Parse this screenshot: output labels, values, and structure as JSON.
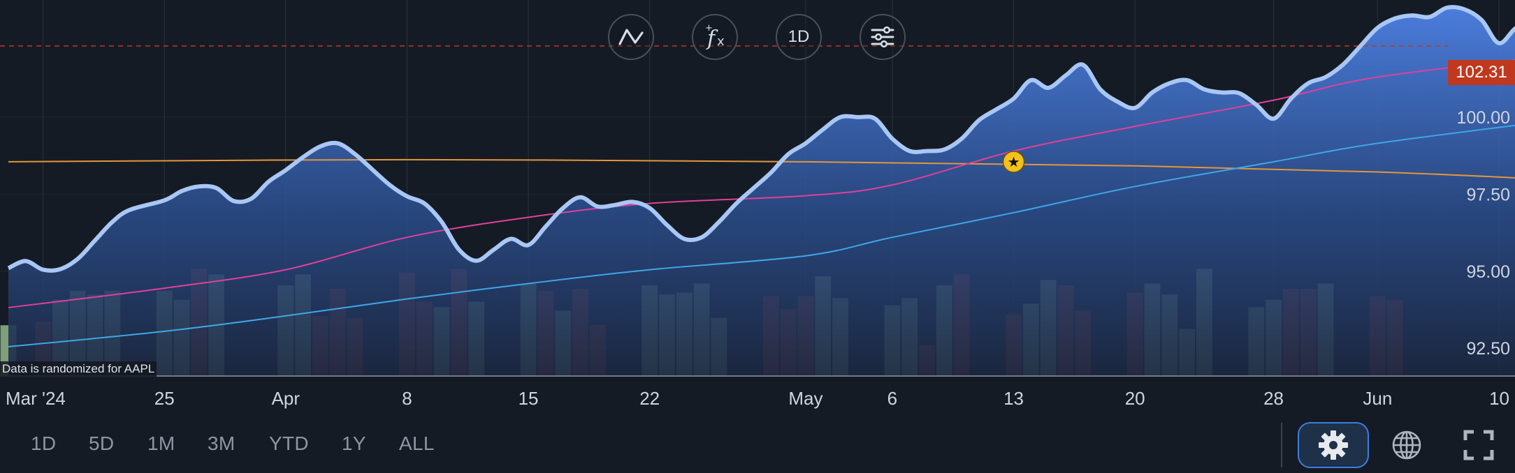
{
  "toolbar": {
    "chart_type_icon": "line-chart-icon",
    "indicator_icon": "function-fx-icon",
    "interval_label": "1D",
    "settings_icon": "sliders-icon"
  },
  "ranges": [
    "1D",
    "5D",
    "1M",
    "3M",
    "YTD",
    "1Y",
    "ALL"
  ],
  "disclaimer": "Data is randomized for AAPL",
  "last_price": "102.31",
  "bottom_icons": [
    "gear-icon",
    "globe-icon",
    "fullscreen-icon"
  ],
  "colors": {
    "background": "#151b24",
    "price_line": "#a9c7f5",
    "area_top": "#4e82e6",
    "area_bottom": "#1b2740",
    "ma_pink": "#e0409a",
    "ma_blue": "#3fa6e6",
    "ma_orange": "#e4963a",
    "volume_up": "#7e9f79",
    "volume_down": "#8c3a2e",
    "price_tag": "#c0391f",
    "accent": "#3d7de0"
  },
  "chart_data": {
    "type": "line",
    "symbol": "AAPL",
    "interval": "1D",
    "x_ticks": [
      {
        "label": "Mar '24",
        "date": "2024-03-18"
      },
      {
        "label": "25",
        "date": "2024-03-25"
      },
      {
        "label": "Apr",
        "date": "2024-04-01"
      },
      {
        "label": "8",
        "date": "2024-04-08"
      },
      {
        "label": "15",
        "date": "2024-04-15"
      },
      {
        "label": "22",
        "date": "2024-04-22"
      },
      {
        "label": "May",
        "date": "2024-05-01"
      },
      {
        "label": "6",
        "date": "2024-05-06"
      },
      {
        "label": "13",
        "date": "2024-05-13"
      },
      {
        "label": "20",
        "date": "2024-05-20"
      },
      {
        "label": "28",
        "date": "2024-05-28"
      },
      {
        "label": "Jun",
        "date": "2024-06-03"
      },
      {
        "label": "10",
        "date": "2024-06-10"
      }
    ],
    "y_ticks": [
      "92.50",
      "95.00",
      "97.50",
      "100.00"
    ],
    "y_tick_values": [
      92.5,
      95.0,
      97.5,
      100.0
    ],
    "ylim": [
      91.6,
      103.8
    ],
    "xlim": [
      "2024-03-16",
      "2024-06-10"
    ],
    "price_series": [
      [
        "2024-03-16",
        95.1
      ],
      [
        "2024-03-17",
        95.33
      ],
      [
        "2024-03-18",
        95.05
      ],
      [
        "2024-03-19",
        95.07
      ],
      [
        "2024-03-20",
        95.4
      ],
      [
        "2024-03-21",
        96.0
      ],
      [
        "2024-03-22",
        96.6
      ],
      [
        "2024-03-23",
        96.99
      ],
      [
        "2024-03-25",
        97.3
      ],
      [
        "2024-03-26",
        97.6
      ],
      [
        "2024-03-27",
        97.75
      ],
      [
        "2024-03-28",
        97.7
      ],
      [
        "2024-03-29",
        97.28
      ],
      [
        "2024-03-30",
        97.35
      ],
      [
        "2024-03-31",
        97.9
      ],
      [
        "2024-04-01",
        98.28
      ],
      [
        "2024-04-02",
        98.7
      ],
      [
        "2024-04-03",
        99.05
      ],
      [
        "2024-04-04",
        99.15
      ],
      [
        "2024-04-05",
        98.8
      ],
      [
        "2024-04-06",
        98.3
      ],
      [
        "2024-04-07",
        97.8
      ],
      [
        "2024-04-08",
        97.43
      ],
      [
        "2024-04-09",
        97.2
      ],
      [
        "2024-04-10",
        96.6
      ],
      [
        "2024-04-11",
        95.7
      ],
      [
        "2024-04-12",
        95.34
      ],
      [
        "2024-04-13",
        95.7
      ],
      [
        "2024-04-14",
        96.05
      ],
      [
        "2024-04-15",
        95.85
      ],
      [
        "2024-04-16",
        96.45
      ],
      [
        "2024-04-17",
        97.05
      ],
      [
        "2024-04-18",
        97.4
      ],
      [
        "2024-04-19",
        97.1
      ],
      [
        "2024-04-20",
        97.15
      ],
      [
        "2024-04-21",
        97.25
      ],
      [
        "2024-04-22",
        97.05
      ],
      [
        "2024-04-23",
        96.5
      ],
      [
        "2024-04-24",
        96.05
      ],
      [
        "2024-04-25",
        96.1
      ],
      [
        "2024-04-26",
        96.6
      ],
      [
        "2024-04-27",
        97.2
      ],
      [
        "2024-04-28",
        97.7
      ],
      [
        "2024-04-29",
        98.2
      ],
      [
        "2024-04-30",
        98.8
      ],
      [
        "2024-05-01",
        99.15
      ],
      [
        "2024-05-02",
        99.6
      ],
      [
        "2024-05-03",
        100.0
      ],
      [
        "2024-05-04",
        100.0
      ],
      [
        "2024-05-05",
        99.95
      ],
      [
        "2024-05-06",
        99.3
      ],
      [
        "2024-05-07",
        98.9
      ],
      [
        "2024-05-08",
        98.9
      ],
      [
        "2024-05-09",
        98.95
      ],
      [
        "2024-05-10",
        99.3
      ],
      [
        "2024-05-11",
        99.9
      ],
      [
        "2024-05-12",
        100.25
      ],
      [
        "2024-05-13",
        100.6
      ],
      [
        "2024-05-14",
        101.2
      ],
      [
        "2024-05-15",
        100.95
      ],
      [
        "2024-05-16",
        101.35
      ],
      [
        "2024-05-17",
        101.7
      ],
      [
        "2024-05-18",
        100.9
      ],
      [
        "2024-05-19",
        100.5
      ],
      [
        "2024-05-20",
        100.3
      ],
      [
        "2024-05-21",
        100.8
      ],
      [
        "2024-05-22",
        101.1
      ],
      [
        "2024-05-23",
        101.2
      ],
      [
        "2024-05-24",
        100.9
      ],
      [
        "2024-05-25",
        100.8
      ],
      [
        "2024-05-26",
        100.78
      ],
      [
        "2024-05-27",
        100.4
      ],
      [
        "2024-05-28",
        99.95
      ],
      [
        "2024-05-29",
        100.6
      ],
      [
        "2024-05-30",
        101.1
      ],
      [
        "2024-05-31",
        101.3
      ],
      [
        "2024-06-01",
        101.7
      ],
      [
        "2024-06-02",
        102.3
      ],
      [
        "2024-06-03",
        102.9
      ],
      [
        "2024-06-04",
        103.2
      ],
      [
        "2024-06-05",
        103.3
      ],
      [
        "2024-06-06",
        103.25
      ],
      [
        "2024-06-07",
        103.55
      ],
      [
        "2024-06-08",
        103.5
      ],
      [
        "2024-06-09",
        103.15
      ],
      [
        "2024-06-10",
        102.4
      ],
      [
        "2024-06-11",
        102.9
      ],
      [
        "2024-06-12",
        103.0
      ],
      [
        "2024-06-13",
        102.8
      ],
      [
        "2024-06-14",
        102.31
      ]
    ],
    "ma_pink": [
      [
        "2024-03-16",
        93.82
      ],
      [
        "2024-03-25",
        94.45
      ],
      [
        "2024-04-01",
        95.05
      ],
      [
        "2024-04-08",
        96.1
      ],
      [
        "2024-04-15",
        96.75
      ],
      [
        "2024-04-22",
        97.2
      ],
      [
        "2024-05-01",
        97.45
      ],
      [
        "2024-05-06",
        97.8
      ],
      [
        "2024-05-13",
        98.9
      ],
      [
        "2024-05-20",
        99.7
      ],
      [
        "2024-05-28",
        100.55
      ],
      [
        "2024-06-03",
        101.3
      ],
      [
        "2024-06-14",
        102.05
      ]
    ],
    "ma_blue": [
      [
        "2024-03-16",
        92.55
      ],
      [
        "2024-03-25",
        93.05
      ],
      [
        "2024-04-01",
        93.55
      ],
      [
        "2024-04-08",
        94.1
      ],
      [
        "2024-04-15",
        94.6
      ],
      [
        "2024-04-22",
        95.05
      ],
      [
        "2024-05-01",
        95.5
      ],
      [
        "2024-05-06",
        96.1
      ],
      [
        "2024-05-13",
        96.9
      ],
      [
        "2024-05-20",
        97.75
      ],
      [
        "2024-05-28",
        98.55
      ],
      [
        "2024-06-03",
        99.15
      ],
      [
        "2024-06-14",
        99.95
      ]
    ],
    "ma_orange": [
      [
        "2024-03-16",
        98.55
      ],
      [
        "2024-04-08",
        98.62
      ],
      [
        "2024-05-01",
        98.55
      ],
      [
        "2024-05-20",
        98.42
      ],
      [
        "2024-06-03",
        98.22
      ],
      [
        "2024-06-14",
        97.95
      ]
    ],
    "marker": {
      "date": "2024-05-13",
      "value": 98.55,
      "icon": "star-icon"
    },
    "reference_line": 102.31,
    "volume": [
      {
        "date": "2024-03-15",
        "v": 0.5,
        "up": false
      },
      {
        "date": "2024-03-16",
        "v": 0.28,
        "up": true
      },
      {
        "date": "2024-03-18",
        "v": 0.3,
        "up": false
      },
      {
        "date": "2024-03-19",
        "v": 0.42,
        "up": true
      },
      {
        "date": "2024-03-20",
        "v": 0.47,
        "up": true
      },
      {
        "date": "2024-03-21",
        "v": 0.45,
        "up": true
      },
      {
        "date": "2024-03-22",
        "v": 0.47,
        "up": true
      },
      {
        "date": "2024-03-25",
        "v": 0.47,
        "up": true
      },
      {
        "date": "2024-03-26",
        "v": 0.42,
        "up": true
      },
      {
        "date": "2024-03-27",
        "v": 0.59,
        "up": false
      },
      {
        "date": "2024-03-28",
        "v": 0.56,
        "up": true
      },
      {
        "date": "2024-04-01",
        "v": 0.5,
        "up": true
      },
      {
        "date": "2024-04-02",
        "v": 0.56,
        "up": true
      },
      {
        "date": "2024-04-03",
        "v": 0.33,
        "up": false
      },
      {
        "date": "2024-04-04",
        "v": 0.48,
        "up": false
      },
      {
        "date": "2024-04-05",
        "v": 0.32,
        "up": false
      },
      {
        "date": "2024-04-08",
        "v": 0.57,
        "up": false
      },
      {
        "date": "2024-04-09",
        "v": 0.41,
        "up": false
      },
      {
        "date": "2024-04-10",
        "v": 0.38,
        "up": true
      },
      {
        "date": "2024-04-11",
        "v": 0.59,
        "up": false
      },
      {
        "date": "2024-04-12",
        "v": 0.41,
        "up": true
      },
      {
        "date": "2024-04-15",
        "v": 0.51,
        "up": true
      },
      {
        "date": "2024-04-16",
        "v": 0.47,
        "up": false
      },
      {
        "date": "2024-04-17",
        "v": 0.36,
        "up": true
      },
      {
        "date": "2024-04-18",
        "v": 0.48,
        "up": false
      },
      {
        "date": "2024-04-19",
        "v": 0.28,
        "up": false
      },
      {
        "date": "2024-04-22",
        "v": 0.5,
        "up": true
      },
      {
        "date": "2024-04-23",
        "v": 0.45,
        "up": true
      },
      {
        "date": "2024-04-24",
        "v": 0.46,
        "up": true
      },
      {
        "date": "2024-04-25",
        "v": 0.51,
        "up": true
      },
      {
        "date": "2024-04-26",
        "v": 0.32,
        "up": true
      },
      {
        "date": "2024-04-29",
        "v": 0.44,
        "up": false
      },
      {
        "date": "2024-04-30",
        "v": 0.37,
        "up": false
      },
      {
        "date": "2024-05-01",
        "v": 0.44,
        "up": false
      },
      {
        "date": "2024-05-02",
        "v": 0.55,
        "up": true
      },
      {
        "date": "2024-05-03",
        "v": 0.43,
        "up": true
      },
      {
        "date": "2024-05-06",
        "v": 0.39,
        "up": true
      },
      {
        "date": "2024-05-07",
        "v": 0.43,
        "up": true
      },
      {
        "date": "2024-05-08",
        "v": 0.17,
        "up": false
      },
      {
        "date": "2024-05-09",
        "v": 0.5,
        "up": true
      },
      {
        "date": "2024-05-10",
        "v": 0.56,
        "up": false
      },
      {
        "date": "2024-05-13",
        "v": 0.34,
        "up": false
      },
      {
        "date": "2024-05-14",
        "v": 0.4,
        "up": true
      },
      {
        "date": "2024-05-15",
        "v": 0.53,
        "up": true
      },
      {
        "date": "2024-05-16",
        "v": 0.5,
        "up": false
      },
      {
        "date": "2024-05-17",
        "v": 0.36,
        "up": false
      },
      {
        "date": "2024-05-20",
        "v": 0.46,
        "up": false
      },
      {
        "date": "2024-05-21",
        "v": 0.51,
        "up": true
      },
      {
        "date": "2024-05-22",
        "v": 0.45,
        "up": true
      },
      {
        "date": "2024-05-23",
        "v": 0.26,
        "up": true
      },
      {
        "date": "2024-05-24",
        "v": 0.59,
        "up": true
      },
      {
        "date": "2024-05-27",
        "v": 0.38,
        "up": true
      },
      {
        "date": "2024-05-28",
        "v": 0.42,
        "up": true
      },
      {
        "date": "2024-05-29",
        "v": 0.48,
        "up": false
      },
      {
        "date": "2024-05-30",
        "v": 0.48,
        "up": false
      },
      {
        "date": "2024-05-31",
        "v": 0.51,
        "up": true
      },
      {
        "date": "2024-06-03",
        "v": 0.44,
        "up": false
      },
      {
        "date": "2024-06-04",
        "v": 0.42,
        "up": false
      }
    ]
  }
}
